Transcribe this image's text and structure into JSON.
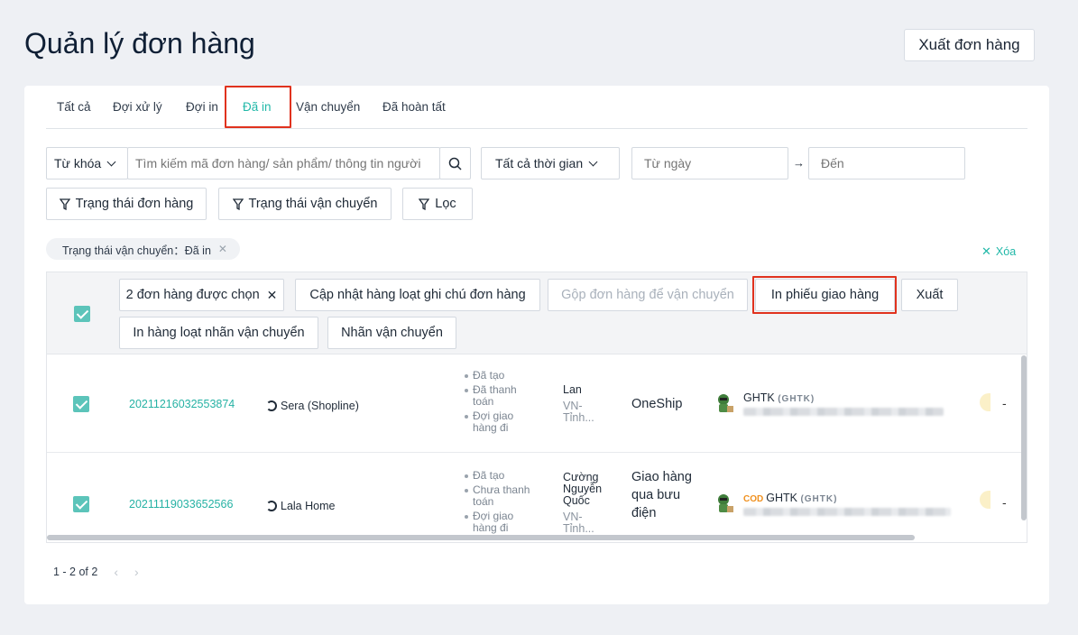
{
  "page": {
    "title": "Quản lý đơn hàng",
    "export_label": "Xuất đơn hàng"
  },
  "tabs": [
    {
      "label": "Tất cả"
    },
    {
      "label": "Đợi xử lý"
    },
    {
      "label": "Đợi in"
    },
    {
      "label": "Đã in",
      "active": true
    },
    {
      "label": "Vận chuyển"
    },
    {
      "label": "Đã hoàn tất"
    }
  ],
  "filters": {
    "keyword_select": "Từ khóa",
    "search_placeholder": "Tìm kiếm mã đơn hàng/ sản phẩm/ thông tin người",
    "time_select": "Tất cả thời gian",
    "from_placeholder": "Từ ngày",
    "to_placeholder": "Đến",
    "order_status": "Trạng thái đơn hàng",
    "shipping_status": "Trạng thái vận chuyển",
    "filter": "Lọc"
  },
  "active_filter": {
    "label": "Trạng thái vận chuyển：Đã in",
    "clear_all": "Xóa"
  },
  "bulk": {
    "selected": "2 đơn hàng được chọn",
    "update_notes": "Cập nhật hàng loạt ghi chú đơn hàng",
    "merge": "Gộp đơn hàng để vận chuyển",
    "print_delivery": "In phiếu giao hàng",
    "export": "Xuất",
    "print_labels": "In hàng loạt nhãn vận chuyển",
    "labels": "Nhãn vận chuyển"
  },
  "orders": [
    {
      "id": "20211216032553874",
      "shop": "Sera (Shopline)",
      "status": [
        "Đã tạo",
        "Đã thanh toán",
        "Đợi giao hàng đi"
      ],
      "customer_name": "Lan",
      "customer_address": "VN-Tỉnh...",
      "carrier": "OneShip",
      "logistics": "GHTK",
      "logistics_sub": "(GHTK)",
      "cod": "",
      "dash": "-"
    },
    {
      "id": "20211119033652566",
      "shop": "Lala Home",
      "status": [
        "Đã tạo",
        "Chưa thanh toán",
        "Đợi giao hàng đi"
      ],
      "customer_name": "Cường Nguyễn Quốc",
      "customer_address": "VN-Tỉnh...",
      "carrier": "Giao hàng qua bưu điện",
      "logistics": "GHTK",
      "logistics_sub": "(GHTK)",
      "cod": "COD",
      "dash": "-"
    }
  ],
  "pagination": {
    "range": "1 - 2 of 2"
  },
  "colors": {
    "accent": "#21b8a8",
    "highlight": "#e0321e",
    "checkbox": "#5cc4ba"
  }
}
